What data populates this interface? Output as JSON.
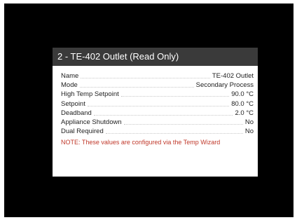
{
  "dialog": {
    "title": "2 - TE-402 Outlet (Read Only)",
    "rows": [
      {
        "label": "Name",
        "value": "TE-402 Outlet"
      },
      {
        "label": "Mode",
        "value": "Secondary Process"
      },
      {
        "label": "High Temp Setpoint",
        "value": "90.0 °C"
      },
      {
        "label": "Setpoint",
        "value": "80.0 °C"
      },
      {
        "label": "Deadband",
        "value": "2.0 °C"
      },
      {
        "label": "Appliance Shutdown",
        "value": "No"
      },
      {
        "label": "Dual Required",
        "value": "No"
      }
    ],
    "note": "NOTE: These values are configured via the Temp Wizard"
  },
  "colors": {
    "header_bg": "#3a3a3a",
    "note_text": "#c0392b",
    "screen_bg": "#000000"
  }
}
